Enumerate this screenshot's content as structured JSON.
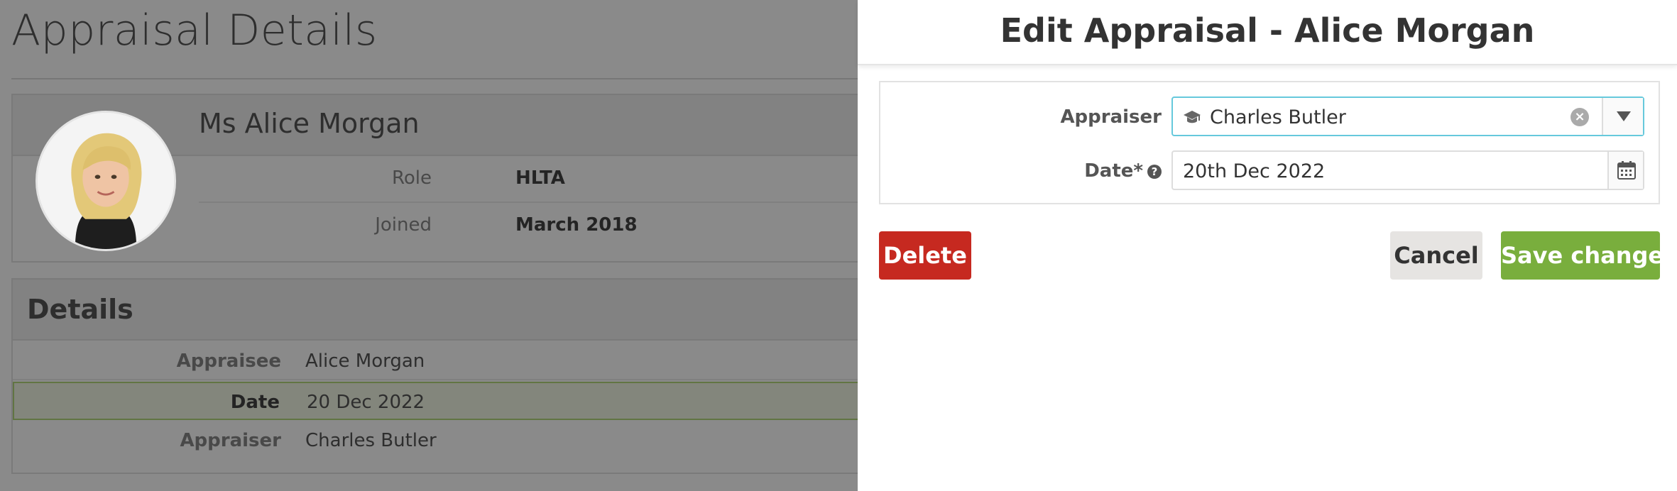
{
  "background": {
    "page_title": "Appraisal Details",
    "profile": {
      "name": "Ms Alice Morgan",
      "rows": [
        {
          "label": "Role",
          "value": "HLTA"
        },
        {
          "label": "Joined",
          "value": "March 2018"
        }
      ]
    },
    "details": {
      "title": "Details",
      "rows": [
        {
          "label": "Appraisee",
          "value": "Alice Morgan"
        },
        {
          "label": "Date",
          "value": "20 Dec 2022"
        },
        {
          "label": "Appraiser",
          "value": "Charles Butler"
        }
      ]
    }
  },
  "panel": {
    "title": "Edit Appraisal - Alice Morgan",
    "appraiser": {
      "label": "Appraiser",
      "value": "Charles Butler",
      "icon": "graduation-cap-icon",
      "clear_glyph": "×"
    },
    "date": {
      "label": "Date*",
      "help_glyph": "?",
      "value": "20th Dec 2022",
      "icon": "calendar-icon"
    },
    "buttons": {
      "delete": "Delete",
      "cancel": "Cancel",
      "save": "Save changes"
    }
  },
  "colors": {
    "delete": "#c62920",
    "save": "#79ae3d",
    "cancel": "#e6e4e2",
    "focus": "#66c9dc"
  }
}
